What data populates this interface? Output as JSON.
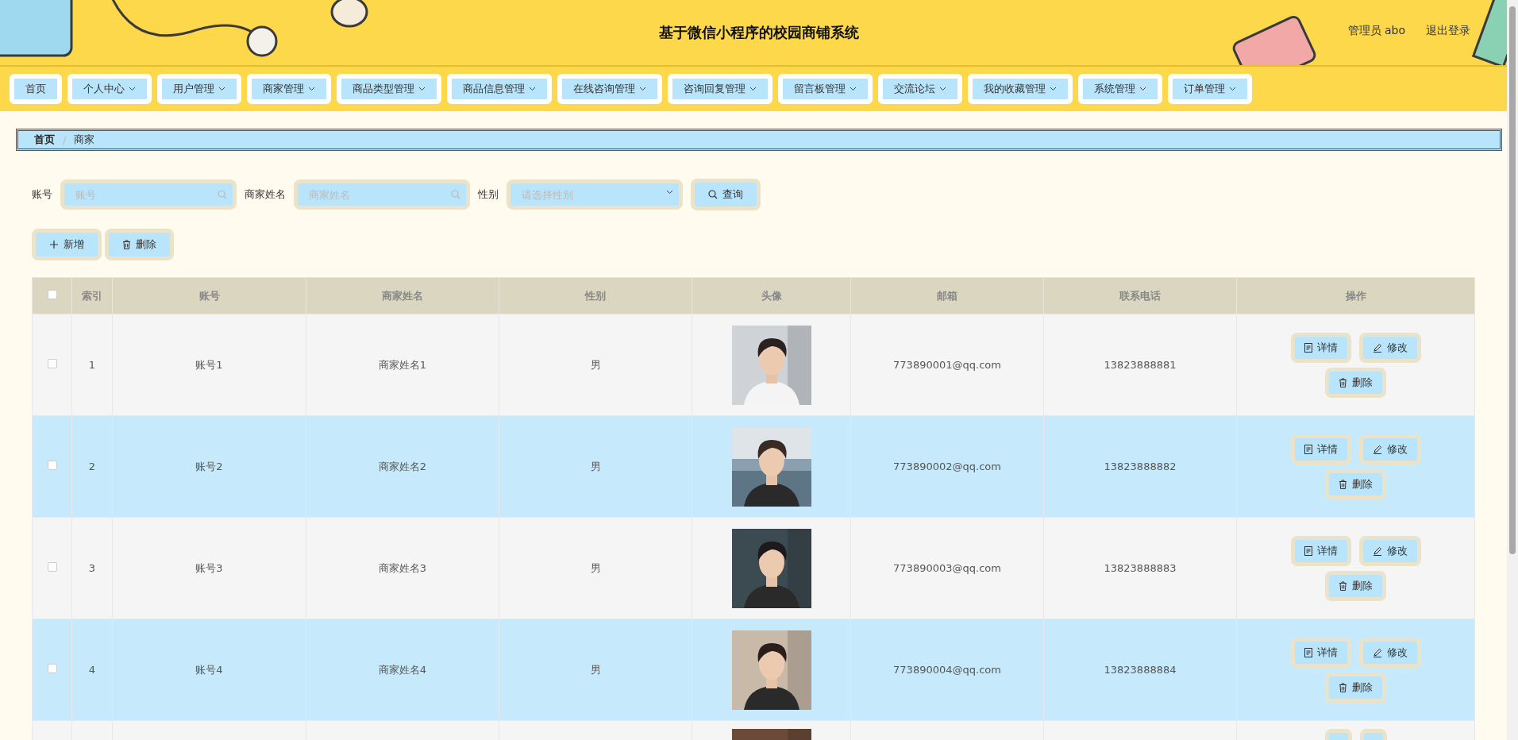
{
  "header": {
    "title": "基于微信小程序的校园商铺系统",
    "user": "管理员 abo",
    "logout": "退出登录"
  },
  "nav": [
    {
      "label": "首页",
      "dropdown": false
    },
    {
      "label": "个人中心",
      "dropdown": true
    },
    {
      "label": "用户管理",
      "dropdown": true
    },
    {
      "label": "商家管理",
      "dropdown": true
    },
    {
      "label": "商品类型管理",
      "dropdown": true
    },
    {
      "label": "商品信息管理",
      "dropdown": true
    },
    {
      "label": "在线咨询管理",
      "dropdown": true
    },
    {
      "label": "咨询回复管理",
      "dropdown": true
    },
    {
      "label": "留言板管理",
      "dropdown": true
    },
    {
      "label": "交流论坛",
      "dropdown": true
    },
    {
      "label": "我的收藏管理",
      "dropdown": true
    },
    {
      "label": "系统管理",
      "dropdown": true
    },
    {
      "label": "订单管理",
      "dropdown": true
    }
  ],
  "breadcrumb": {
    "items": [
      "首页",
      "商家"
    ],
    "separator": "/"
  },
  "filters": [
    {
      "label": "账号",
      "placeholder": "账号",
      "kind": "text"
    },
    {
      "label": "商家姓名",
      "placeholder": "商家姓名",
      "kind": "text"
    },
    {
      "label": "性别",
      "placeholder": "请选择性别",
      "kind": "select"
    }
  ],
  "search_button": "查询",
  "actions": [
    {
      "label": "新增",
      "kind": "add"
    },
    {
      "label": "删除",
      "kind": "delete"
    }
  ],
  "table": {
    "select_all": false,
    "columns": [
      "索引",
      "账号",
      "商家姓名",
      "性别",
      "头像",
      "邮箱",
      "联系电话",
      "操作"
    ],
    "rows": [
      {
        "checked": false,
        "index": "1",
        "account": "账号1",
        "name": "商家姓名1",
        "gender": "男",
        "email": "773890001@qq.com",
        "phone": "13823888881",
        "actions": [
          {
            "label": "详情",
            "kind": "detail"
          },
          {
            "label": "修改",
            "kind": "edit"
          },
          {
            "label": "删除",
            "kind": "delete"
          }
        ]
      },
      {
        "checked": false,
        "index": "2",
        "account": "账号2",
        "name": "商家姓名2",
        "gender": "男",
        "email": "773890002@qq.com",
        "phone": "13823888882",
        "actions": [
          {
            "label": "详情",
            "kind": "detail"
          },
          {
            "label": "修改",
            "kind": "edit"
          },
          {
            "label": "删除",
            "kind": "delete"
          }
        ]
      },
      {
        "checked": false,
        "index": "3",
        "account": "账号3",
        "name": "商家姓名3",
        "gender": "男",
        "email": "773890003@qq.com",
        "phone": "13823888883",
        "actions": [
          {
            "label": "详情",
            "kind": "detail"
          },
          {
            "label": "修改",
            "kind": "edit"
          },
          {
            "label": "删除",
            "kind": "delete"
          }
        ]
      },
      {
        "checked": false,
        "index": "4",
        "account": "账号4",
        "name": "商家姓名4",
        "gender": "男",
        "email": "773890004@qq.com",
        "phone": "13823888884",
        "actions": [
          {
            "label": "详情",
            "kind": "detail"
          },
          {
            "label": "修改",
            "kind": "edit"
          },
          {
            "label": "删除",
            "kind": "delete"
          }
        ]
      },
      {
        "kind": "partial",
        "actions": [
          {
            "kind": "detail"
          },
          {
            "kind": "edit"
          }
        ]
      }
    ]
  }
}
